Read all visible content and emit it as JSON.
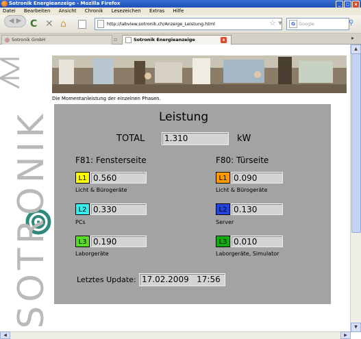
{
  "window": {
    "title": "Sotronik Energieanzeige - Mozilla Firefox"
  },
  "menu": [
    "Datei",
    "Bearbeiten",
    "Ansicht",
    "Chronik",
    "Lesezeichen",
    "Extras",
    "Hilfe"
  ],
  "nav": {
    "url": "http://labview.sotronik.ch/Anzeige_Leistung.html",
    "search_placeholder": "Google"
  },
  "tabs": [
    {
      "label": "Sotronik GmbH"
    },
    {
      "label": "Sotronik Energieanzeige"
    }
  ],
  "page": {
    "logo_text": "SOTRONIK",
    "caption": "Die Momentanleistung der einzelnen Phasen.",
    "heading": "Leistung",
    "total": {
      "label": "TOTAL",
      "value": "1.310",
      "unit": "kW"
    },
    "groups": [
      {
        "title": "F81: Fensterseite",
        "phases": [
          {
            "tag": "L1",
            "value": "0.560",
            "desc": "Licht & Bürogeräte",
            "color": "#ffff00"
          },
          {
            "tag": "L2",
            "value": "0.330",
            "desc": "PCs",
            "color": "#33eeee"
          },
          {
            "tag": "L3",
            "value": "0.190",
            "desc": "Laborgeräte",
            "color": "#55dd22"
          }
        ]
      },
      {
        "title": "F80: Türseite",
        "phases": [
          {
            "tag": "L1",
            "value": "0.090",
            "desc": "Licht & Bürogeräte",
            "color": "#ff9900"
          },
          {
            "tag": "L2",
            "value": "0.130",
            "desc": "Server",
            "color": "#2244dd"
          },
          {
            "tag": "L3",
            "value": "0.010",
            "desc": "Laborgeräte, Simulator",
            "color": "#11aa11"
          }
        ]
      }
    ],
    "update": {
      "label": "Letztes Update:",
      "value": "17.02.2009   17:56"
    }
  }
}
